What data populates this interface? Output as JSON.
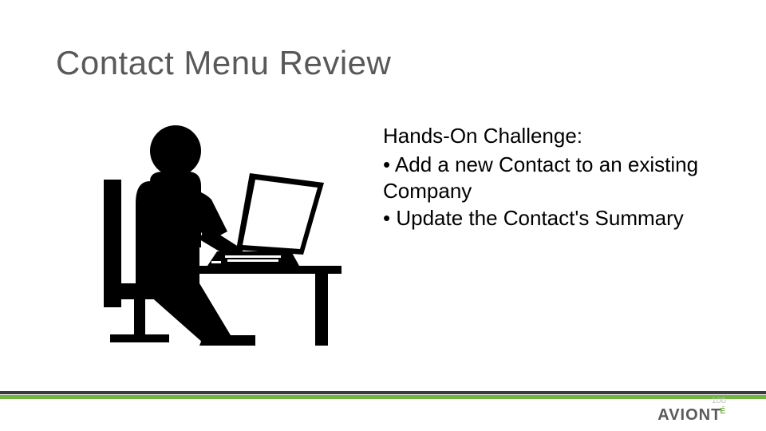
{
  "title": "Contact Menu Review",
  "content": {
    "heading": "Hands-On Challenge:",
    "bullets": [
      "Add a new Contact to an existing Company",
      "Update the Contact's Summary"
    ]
  },
  "footer": {
    "logo_text": "AVIONT",
    "logo_accent": "É",
    "page_number": "100"
  }
}
